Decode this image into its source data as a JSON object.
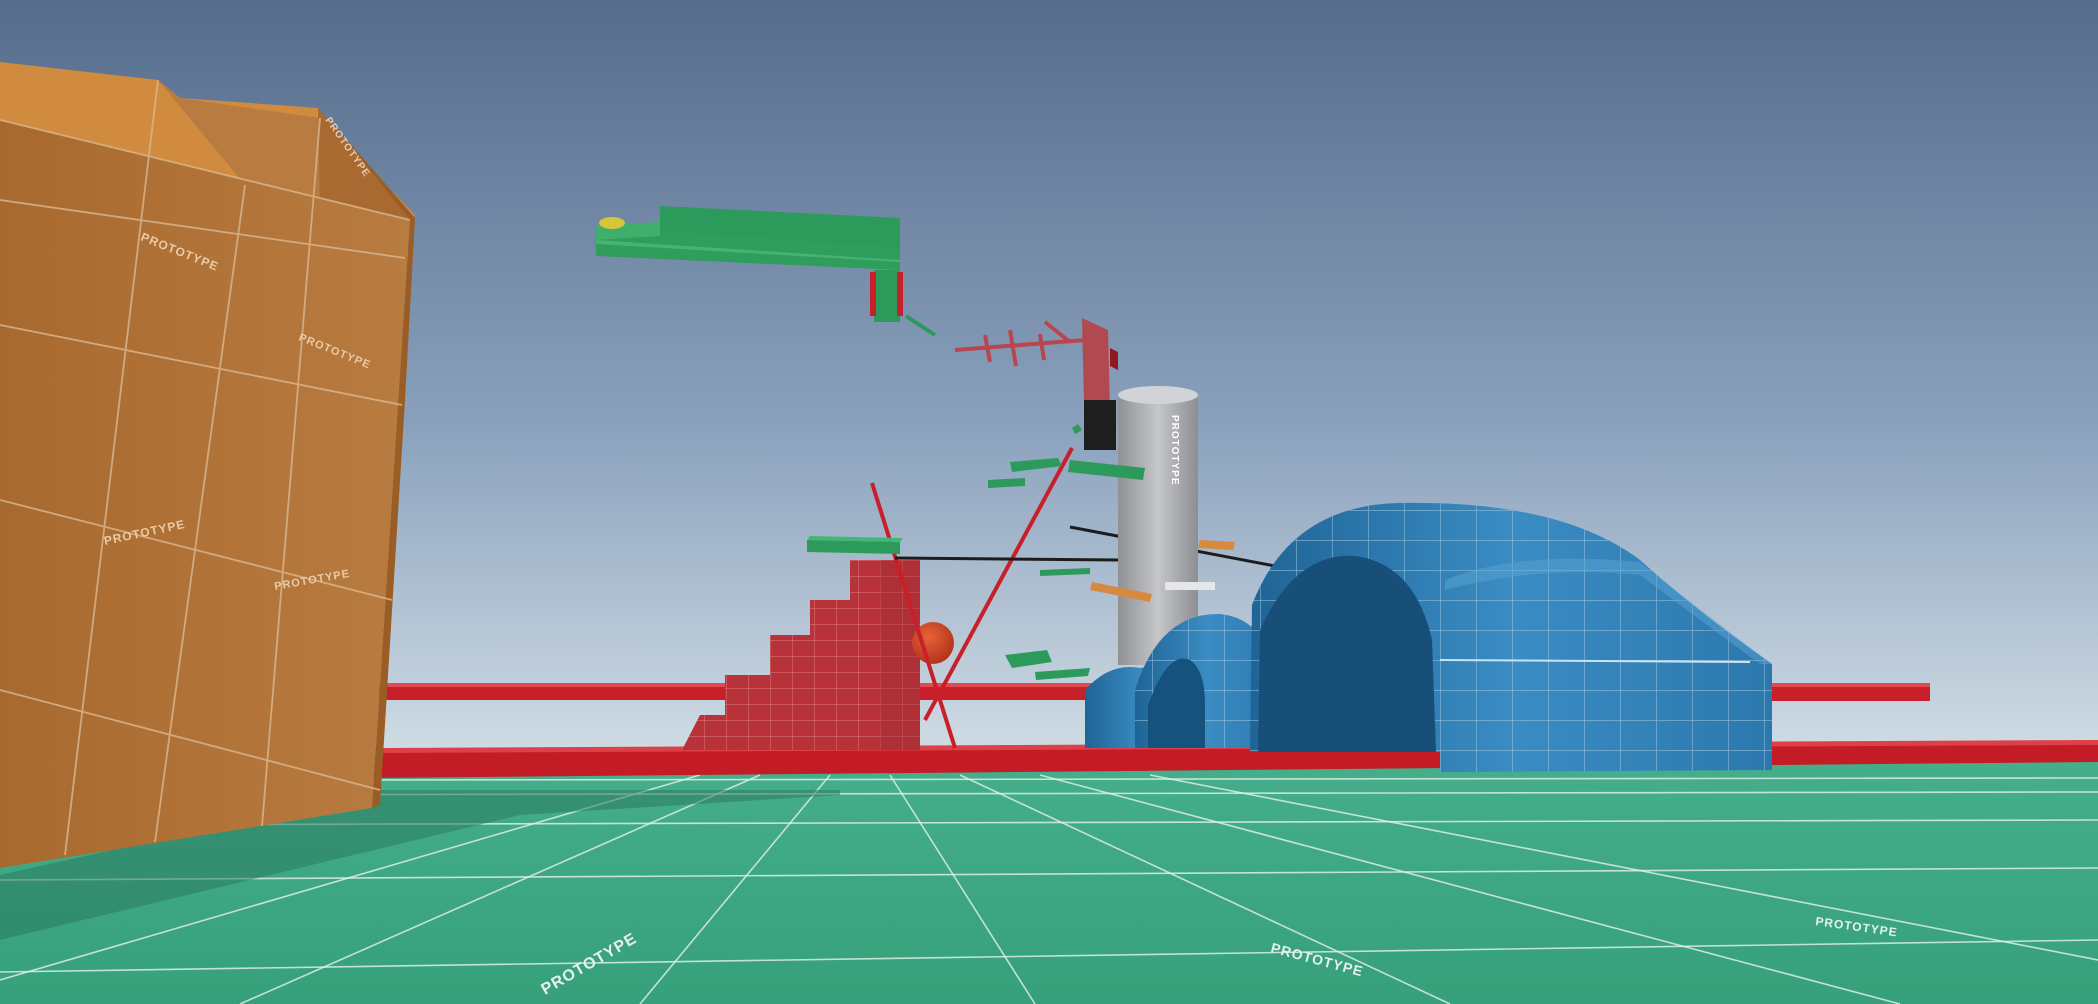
{
  "scene": {
    "view": "third-person 3D prototype level",
    "texture_label": "PROTOTYPE",
    "objects": [
      "orange-prototype-block",
      "green-ground-plane",
      "red-rail-upper",
      "red-rail-lower",
      "red-stair-tower",
      "orange-sphere",
      "grey-cylinder-tower",
      "blue-dome-small",
      "blue-dome-large",
      "floating-green-platforms",
      "red-diagonal-beams",
      "black-cables"
    ]
  },
  "colors": {
    "sky_top": "#566c8c",
    "sky_bottom": "#c8d5df",
    "ground": "#3fa884",
    "ground_grid": "#e8f2ee",
    "orange_block": "#b5773a",
    "orange_block_top": "#d08b3f",
    "red": "#c8202a",
    "blue_dome": "#2f7fb5",
    "green_platform": "#2c9a5a",
    "grey_cylinder": "#a7a9ac"
  }
}
